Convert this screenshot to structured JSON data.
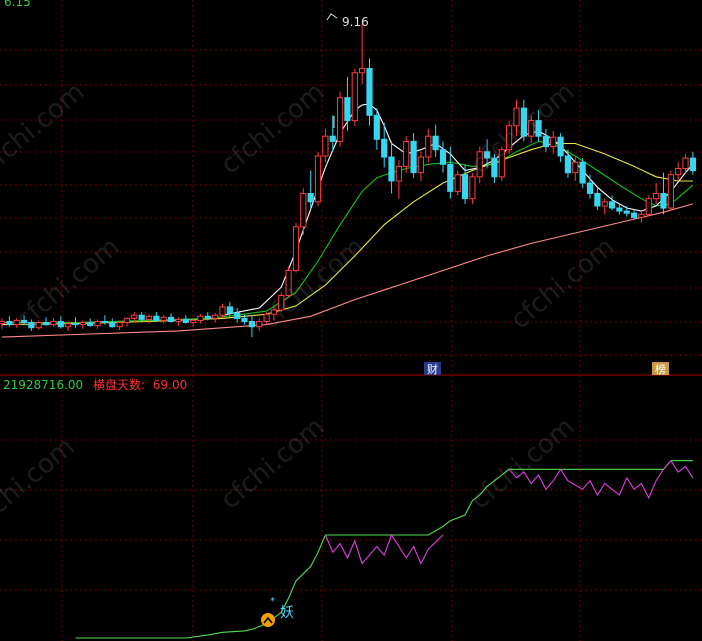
{
  "colors": {
    "background": "#000000",
    "grid": "#7a0000",
    "up": "#ff3b3b",
    "down": "#36d6f0",
    "ma_white": "#ffffff",
    "ma_yellow": "#e8e84a",
    "ma_green": "#18c018",
    "ma_pink": "#ff8a8a",
    "indicator_green": "#50e050",
    "indicator_magenta": "#e040e0",
    "header_value": "#2ecc40",
    "header_label": "#ff3030",
    "annotation": "#e0e0e0",
    "badge_bg": "#2a3a8a",
    "badge_bg_2": "#c79a40"
  },
  "top_left_partial": "6.15",
  "peak_annotation": "9.16",
  "markers": {
    "cai": "财",
    "bang": "榜",
    "yao": "妖"
  },
  "indicator_header": {
    "value": "21928716.00",
    "label": "横盘天数:",
    "days": "69.00"
  },
  "watermark": "cfchi.com",
  "chart_data": [
    {
      "type": "candlestick",
      "title": "",
      "y_range": [
        5.9,
        9.32
      ],
      "candles": [
        [
          6.25,
          6.3,
          6.2,
          6.27
        ],
        [
          6.27,
          6.32,
          6.22,
          6.24
        ],
        [
          6.24,
          6.3,
          6.21,
          6.28
        ],
        [
          6.28,
          6.33,
          6.24,
          6.26
        ],
        [
          6.26,
          6.29,
          6.18,
          6.21
        ],
        [
          6.21,
          6.28,
          6.19,
          6.26
        ],
        [
          6.26,
          6.31,
          6.23,
          6.24
        ],
        [
          6.24,
          6.3,
          6.22,
          6.27
        ],
        [
          6.27,
          6.32,
          6.2,
          6.22
        ],
        [
          6.22,
          6.27,
          6.18,
          6.25
        ],
        [
          6.25,
          6.31,
          6.21,
          6.24
        ],
        [
          6.24,
          6.28,
          6.2,
          6.26
        ],
        [
          6.26,
          6.3,
          6.22,
          6.23
        ],
        [
          6.23,
          6.29,
          6.2,
          6.27
        ],
        [
          6.27,
          6.33,
          6.24,
          6.26
        ],
        [
          6.26,
          6.3,
          6.21,
          6.22
        ],
        [
          6.22,
          6.28,
          6.19,
          6.26
        ],
        [
          6.26,
          6.31,
          6.22,
          6.3
        ],
        [
          6.3,
          6.36,
          6.26,
          6.33
        ],
        [
          6.33,
          6.36,
          6.27,
          6.29
        ],
        [
          6.29,
          6.34,
          6.25,
          6.32
        ],
        [
          6.32,
          6.36,
          6.27,
          6.28
        ],
        [
          6.28,
          6.33,
          6.25,
          6.31
        ],
        [
          6.31,
          6.35,
          6.26,
          6.27
        ],
        [
          6.27,
          6.31,
          6.23,
          6.29
        ],
        [
          6.29,
          6.33,
          6.25,
          6.26
        ],
        [
          6.26,
          6.3,
          6.22,
          6.28
        ],
        [
          6.28,
          6.34,
          6.25,
          6.32
        ],
        [
          6.32,
          6.36,
          6.28,
          6.3
        ],
        [
          6.3,
          6.35,
          6.26,
          6.33
        ],
        [
          6.33,
          6.44,
          6.3,
          6.41
        ],
        [
          6.41,
          6.46,
          6.32,
          6.35
        ],
        [
          6.35,
          6.4,
          6.26,
          6.3
        ],
        [
          6.3,
          6.34,
          6.24,
          6.27
        ],
        [
          6.27,
          6.33,
          6.12,
          6.22
        ],
        [
          6.22,
          6.3,
          6.18,
          6.27
        ],
        [
          6.27,
          6.36,
          6.24,
          6.34
        ],
        [
          6.34,
          6.41,
          6.28,
          6.38
        ],
        [
          6.38,
          6.55,
          6.36,
          6.52
        ],
        [
          6.52,
          6.8,
          6.5,
          6.76
        ],
        [
          6.76,
          7.22,
          6.74,
          7.18
        ],
        [
          7.18,
          7.55,
          7.1,
          7.5
        ],
        [
          7.5,
          7.72,
          7.35,
          7.42
        ],
        [
          7.42,
          7.9,
          7.38,
          7.86
        ],
        [
          7.86,
          8.12,
          7.8,
          8.05
        ],
        [
          8.05,
          8.25,
          7.9,
          8.0
        ],
        [
          8.0,
          8.48,
          7.95,
          8.42
        ],
        [
          8.42,
          8.62,
          8.1,
          8.2
        ],
        [
          8.2,
          8.7,
          8.15,
          8.66
        ],
        [
          8.66,
          9.16,
          8.55,
          8.7
        ],
        [
          8.7,
          8.8,
          8.15,
          8.25
        ],
        [
          8.25,
          8.32,
          7.92,
          8.02
        ],
        [
          8.02,
          8.18,
          7.75,
          7.85
        ],
        [
          7.85,
          8.0,
          7.5,
          7.62
        ],
        [
          7.62,
          7.82,
          7.45,
          7.76
        ],
        [
          7.76,
          8.05,
          7.7,
          8.0
        ],
        [
          8.0,
          8.08,
          7.65,
          7.7
        ],
        [
          7.7,
          7.9,
          7.62,
          7.85
        ],
        [
          7.85,
          8.12,
          7.8,
          8.05
        ],
        [
          8.05,
          8.16,
          7.85,
          7.92
        ],
        [
          7.92,
          8.0,
          7.7,
          7.78
        ],
        [
          7.78,
          7.95,
          7.45,
          7.52
        ],
        [
          7.52,
          7.72,
          7.48,
          7.68
        ],
        [
          7.68,
          7.78,
          7.4,
          7.45
        ],
        [
          7.45,
          7.7,
          7.4,
          7.66
        ],
        [
          7.66,
          7.95,
          7.6,
          7.9
        ],
        [
          7.9,
          8.02,
          7.75,
          7.84
        ],
        [
          7.84,
          7.88,
          7.6,
          7.66
        ],
        [
          7.66,
          7.95,
          7.62,
          7.92
        ],
        [
          7.92,
          8.2,
          7.88,
          8.15
        ],
        [
          8.15,
          8.4,
          8.05,
          8.32
        ],
        [
          8.32,
          8.4,
          8.0,
          8.05
        ],
        [
          8.05,
          8.25,
          7.98,
          8.2
        ],
        [
          8.2,
          8.3,
          8.0,
          8.05
        ],
        [
          8.05,
          8.12,
          7.9,
          7.95
        ],
        [
          7.95,
          8.1,
          7.88,
          8.04
        ],
        [
          8.04,
          8.08,
          7.8,
          7.86
        ],
        [
          7.86,
          7.92,
          7.65,
          7.7
        ],
        [
          7.7,
          7.85,
          7.62,
          7.8
        ],
        [
          7.8,
          7.84,
          7.55,
          7.6
        ],
        [
          7.6,
          7.68,
          7.45,
          7.5
        ],
        [
          7.5,
          7.55,
          7.34,
          7.38
        ],
        [
          7.38,
          7.45,
          7.3,
          7.42
        ],
        [
          7.42,
          7.48,
          7.34,
          7.36
        ],
        [
          7.36,
          7.4,
          7.3,
          7.33
        ],
        [
          7.33,
          7.38,
          7.28,
          7.31
        ],
        [
          7.31,
          7.35,
          7.25,
          7.27
        ],
        [
          7.27,
          7.33,
          7.22,
          7.3
        ],
        [
          7.3,
          7.48,
          7.28,
          7.45
        ],
        [
          7.45,
          7.6,
          7.4,
          7.5
        ],
        [
          7.5,
          7.7,
          7.3,
          7.36
        ],
        [
          7.36,
          7.72,
          7.34,
          7.68
        ],
        [
          7.68,
          7.8,
          7.62,
          7.74
        ],
        [
          7.74,
          7.88,
          7.7,
          7.84
        ],
        [
          7.84,
          7.9,
          7.68,
          7.72
        ]
      ],
      "ma_white": [
        [
          30,
          6.33
        ],
        [
          35,
          6.4
        ],
        [
          38,
          6.6
        ],
        [
          40,
          6.95
        ],
        [
          42,
          7.35
        ],
        [
          44,
          7.75
        ],
        [
          46,
          8.08
        ],
        [
          48,
          8.3
        ],
        [
          49,
          8.35
        ],
        [
          50,
          8.36
        ],
        [
          51,
          8.3
        ],
        [
          52,
          8.15
        ],
        [
          53,
          7.98
        ],
        [
          55,
          7.88
        ],
        [
          57,
          7.92
        ],
        [
          59,
          7.98
        ],
        [
          61,
          7.88
        ],
        [
          63,
          7.72
        ],
        [
          65,
          7.75
        ],
        [
          67,
          7.82
        ],
        [
          69,
          7.94
        ],
        [
          71,
          8.06
        ],
        [
          73,
          8.1
        ],
        [
          75,
          8.02
        ],
        [
          77,
          7.88
        ],
        [
          79,
          7.72
        ],
        [
          81,
          7.56
        ],
        [
          83,
          7.44
        ],
        [
          85,
          7.36
        ],
        [
          87,
          7.33
        ],
        [
          89,
          7.38
        ],
        [
          91,
          7.52
        ],
        [
          93,
          7.7
        ],
        [
          94,
          7.78
        ]
      ],
      "ma_green": [
        [
          0,
          6.26
        ],
        [
          10,
          6.26
        ],
        [
          20,
          6.28
        ],
        [
          28,
          6.3
        ],
        [
          32,
          6.33
        ],
        [
          36,
          6.37
        ],
        [
          40,
          6.55
        ],
        [
          43,
          6.85
        ],
        [
          46,
          7.2
        ],
        [
          49,
          7.52
        ],
        [
          51,
          7.65
        ],
        [
          53,
          7.7
        ],
        [
          55,
          7.74
        ],
        [
          58,
          7.78
        ],
        [
          61,
          7.8
        ],
        [
          64,
          7.76
        ],
        [
          67,
          7.78
        ],
        [
          70,
          7.9
        ],
        [
          73,
          8.0
        ],
        [
          75,
          7.98
        ],
        [
          78,
          7.86
        ],
        [
          81,
          7.72
        ],
        [
          84,
          7.58
        ],
        [
          87,
          7.45
        ],
        [
          89,
          7.38
        ],
        [
          91,
          7.4
        ],
        [
          93,
          7.52
        ],
        [
          94,
          7.58
        ]
      ],
      "ma_yellow": [
        [
          0,
          6.24
        ],
        [
          10,
          6.25
        ],
        [
          20,
          6.27
        ],
        [
          30,
          6.3
        ],
        [
          36,
          6.34
        ],
        [
          40,
          6.42
        ],
        [
          44,
          6.62
        ],
        [
          48,
          6.9
        ],
        [
          52,
          7.2
        ],
        [
          56,
          7.42
        ],
        [
          60,
          7.6
        ],
        [
          64,
          7.72
        ],
        [
          68,
          7.82
        ],
        [
          72,
          7.92
        ],
        [
          75,
          7.98
        ],
        [
          78,
          7.98
        ],
        [
          82,
          7.88
        ],
        [
          86,
          7.76
        ],
        [
          89,
          7.66
        ],
        [
          92,
          7.62
        ],
        [
          94,
          7.62
        ]
      ],
      "ma_pink": [
        [
          0,
          6.12
        ],
        [
          12,
          6.15
        ],
        [
          24,
          6.18
        ],
        [
          36,
          6.24
        ],
        [
          42,
          6.32
        ],
        [
          48,
          6.48
        ],
        [
          54,
          6.62
        ],
        [
          60,
          6.76
        ],
        [
          66,
          6.9
        ],
        [
          72,
          7.02
        ],
        [
          78,
          7.12
        ],
        [
          84,
          7.22
        ],
        [
          90,
          7.32
        ],
        [
          94,
          7.4
        ]
      ]
    },
    {
      "type": "line",
      "title": "",
      "y_range": [
        0,
        100
      ],
      "series": [
        {
          "name": "",
          "values": [
            [
              10,
              0
            ],
            [
              25,
              0
            ],
            [
              28,
              2
            ],
            [
              30,
              4
            ],
            [
              33,
              5
            ],
            [
              34,
              6
            ],
            [
              36,
              10
            ],
            [
              38,
              18
            ],
            [
              39,
              28
            ],
            [
              40,
              40
            ],
            [
              42,
              50
            ],
            [
              43,
              60
            ],
            [
              44,
              72
            ],
            [
              58,
              72
            ],
            [
              60,
              78
            ],
            [
              61,
              82
            ],
            [
              63,
              86
            ],
            [
              64,
              96
            ],
            [
              65,
              100
            ],
            [
              66,
              106
            ],
            [
              68,
              114
            ],
            [
              69,
              118
            ],
            [
              90,
              118
            ],
            [
              91,
              124
            ],
            [
              94,
              124
            ]
          ]
        },
        {
          "name": "",
          "values": [
            [
              44,
              72
            ],
            [
              45,
              60
            ],
            [
              46,
              66
            ],
            [
              47,
              56
            ],
            [
              48,
              68
            ],
            [
              49,
              52
            ],
            [
              51,
              64
            ],
            [
              52,
              58
            ],
            [
              53,
              72
            ],
            [
              55,
              56
            ],
            [
              56,
              64
            ],
            [
              57,
              52
            ],
            [
              58,
              62
            ],
            [
              60,
              72
            ]
          ]
        },
        {
          "name": "",
          "values": [
            [
              69,
              118
            ],
            [
              70,
              112
            ],
            [
              71,
              116
            ],
            [
              72,
              108
            ],
            [
              73,
              114
            ],
            [
              74,
              104
            ],
            [
              75,
              110
            ],
            [
              76,
              118
            ],
            [
              77,
              110
            ],
            [
              79,
              104
            ],
            [
              80,
              110
            ],
            [
              81,
              100
            ],
            [
              82,
              108
            ],
            [
              84,
              100
            ],
            [
              85,
              112
            ],
            [
              86,
              104
            ],
            [
              87,
              108
            ],
            [
              88,
              98
            ],
            [
              89,
              110
            ],
            [
              90,
              118
            ],
            [
              91,
              124
            ],
            [
              92,
              116
            ],
            [
              93,
              120
            ],
            [
              94,
              112
            ]
          ]
        }
      ]
    }
  ]
}
